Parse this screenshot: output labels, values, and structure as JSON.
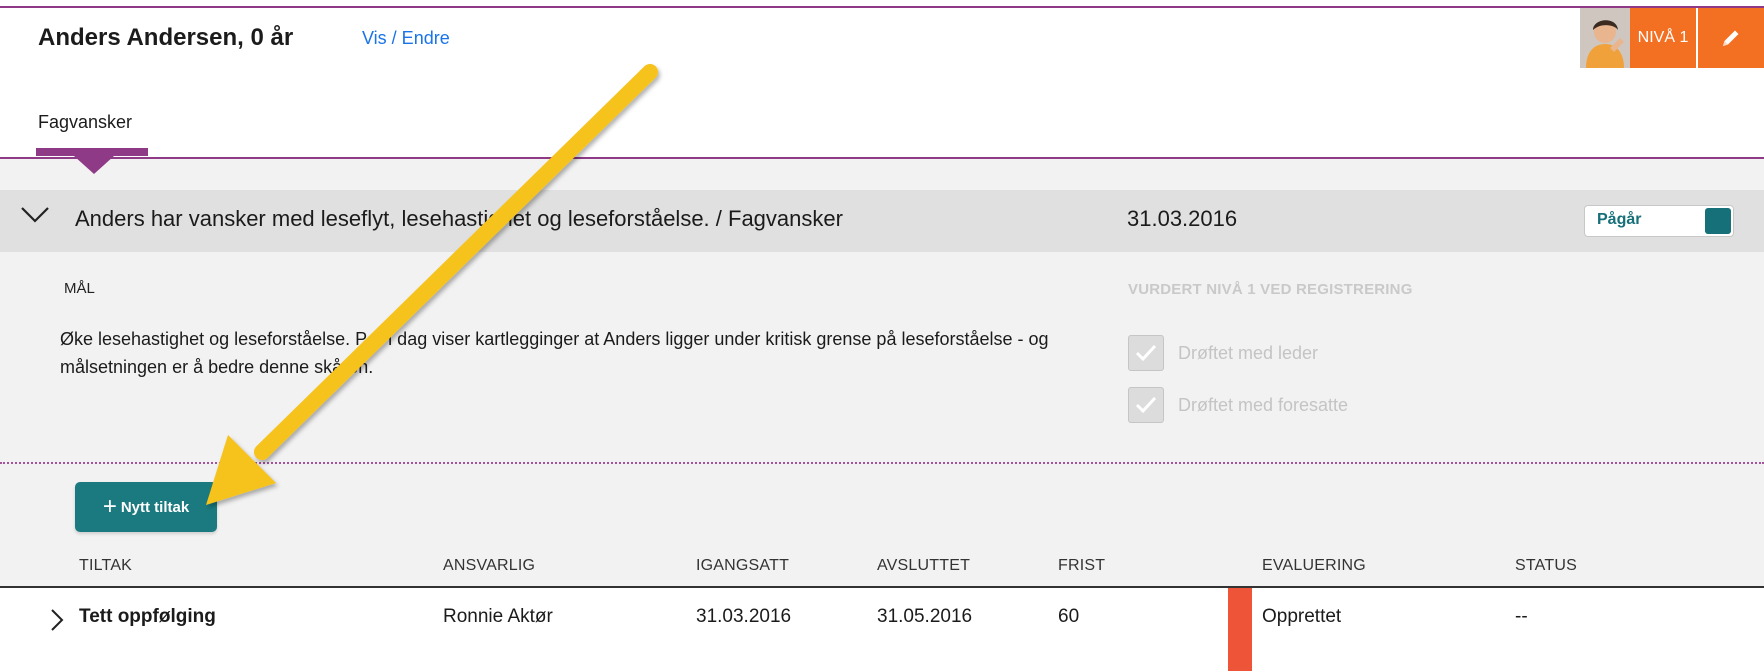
{
  "header": {
    "student_name": "Anders Andersen, 0 år",
    "vis_endre_link": "Vis / Endre",
    "niva_badge": "NIVÅ 1",
    "edit_icon": "pencil-icon",
    "avatar_icon": "user-avatar-photo"
  },
  "tabs": [
    {
      "label": "Fagvansker",
      "active": true
    }
  ],
  "problem": {
    "title": "Anders har vansker med leseflyt, lesehastighet og leseforståelse. / Fagvansker",
    "date": "31.03.2016",
    "status_label": "Pågår",
    "expand_icon": "chevron-down-icon"
  },
  "goal": {
    "heading": "MÅL",
    "text": "Øke lesehastighet og leseforståelse. Per i dag viser kartlegginger at Anders ligger under kritisk grense på leseforståelse - og målsetningen er å bedre denne skåren."
  },
  "assessment": {
    "heading": "VURDERT NIVÅ 1 VED REGISTRERING",
    "checks": [
      {
        "label": "Drøftet med leder",
        "checked": true
      },
      {
        "label": "Drøftet med foresatte",
        "checked": true
      }
    ]
  },
  "tiltak": {
    "new_button": "Nytt tiltak",
    "columns": {
      "tiltak": "TILTAK",
      "ansvarlig": "ANSVARLIG",
      "igangsatt": "IGANGSATT",
      "avsluttet": "AVSLUTTET",
      "frist": "FRIST",
      "evaluering": "EVALUERING",
      "status": "STATUS"
    },
    "rows": [
      {
        "tiltak": "Tett oppfølging",
        "ansvarlig": "Ronnie Aktør",
        "igangsatt": "31.03.2016",
        "avsluttet": "31.05.2016",
        "frist": "60",
        "evaluering": "Opprettet",
        "status": "--"
      }
    ]
  },
  "colors": {
    "accent_purple": "#8e3a86",
    "teal": "#1b7a7f",
    "orange": "#f36f21",
    "annotation_arrow": "#f6c21a",
    "eval_red": "#ee5538"
  }
}
